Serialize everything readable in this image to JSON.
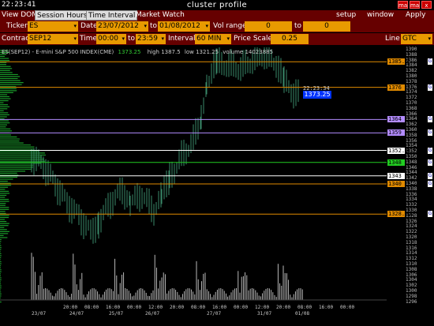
{
  "window": {
    "clock": "22:23:41",
    "title": "cluster profile",
    "btn_min": "ma",
    "btn_max": "ma",
    "btn_close": "x"
  },
  "menu": {
    "tabs": [
      "View DOM",
      "Session Hours",
      "Time Interval",
      "Market Watch"
    ],
    "right": [
      "setup",
      "window",
      "Apply"
    ]
  },
  "controls": {
    "ticker_label": "Ticker",
    "ticker": "ES",
    "date_label": "Date",
    "date_from": "23/07/2012",
    "to1": "to",
    "date_to": "01/08/2012",
    "vol_label": "Vol range",
    "vol_from": "0",
    "to2": "to",
    "vol_to": "0",
    "contract_label": "Contract",
    "contract": "SEP12",
    "time_label": "Time",
    "time_from": "00:00",
    "to3": "to",
    "time_to": "23:59",
    "interval_label": "Interval",
    "interval": "60 MIN",
    "scale_label": "Price Scale",
    "scale": "0.25",
    "line_label": "Line",
    "line": "GTC"
  },
  "chart_info": {
    "symbol": "ES(SEP12) - E-mini S&P 500 INDEX(CME)",
    "last": "1373.25",
    "high": "high 1387.5",
    "low": "low 1321.25",
    "volume": "volume 14023885",
    "time_tag": "22:23:34",
    "price_tag": "1373.25"
  },
  "colors": {
    "menu_bg": "#660000",
    "field_bg": "#e89a00",
    "accent_blue": "#0033ff",
    "orange_line": "#e08a00",
    "purple_line": "#b38cff",
    "green_line": "#22cc22"
  },
  "price_axis": [
    "1390",
    "1388",
    "1386",
    "1384",
    "1382",
    "1380",
    "1378",
    "1376",
    "1374",
    "1372",
    "1370",
    "1368",
    "1366",
    "1364",
    "1362",
    "1360",
    "1358",
    "1356",
    "1354",
    "1352",
    "1350",
    "1348",
    "1346",
    "1344",
    "1342",
    "1340",
    "1338",
    "1336",
    "1334",
    "1332",
    "1330",
    "1328",
    "1326",
    "1324",
    "1322",
    "1320",
    "1318",
    "1316",
    "1314",
    "1312",
    "1310",
    "1308",
    "1306",
    "1304",
    "1302",
    "1300",
    "1298",
    "1296"
  ],
  "level_tags": [
    {
      "price": "1385.5",
      "color": "orange"
    },
    {
      "price": "1376",
      "color": "orange"
    },
    {
      "price": "1364",
      "color": "purple"
    },
    {
      "price": "1359",
      "color": "purple"
    },
    {
      "price": "1352.5",
      "color": "white"
    },
    {
      "price": "1348",
      "color": "green"
    },
    {
      "price": "1343",
      "color": "white"
    },
    {
      "price": "1340",
      "color": "orange"
    },
    {
      "price": "1328.75",
      "color": "orange"
    }
  ],
  "gtc_mark": "G",
  "time_labels": [
    "20:00",
    "08:00",
    "16:00",
    "00:00",
    "12:00",
    "20:00",
    "08:00",
    "16:00",
    "00:00",
    "12:00",
    "20:00",
    "08:00",
    "16:00",
    "00:00"
  ],
  "date_labels": [
    "23/07",
    "24/07",
    "25/07",
    "26/07",
    "27/07",
    "31/07",
    "01/08"
  ]
}
